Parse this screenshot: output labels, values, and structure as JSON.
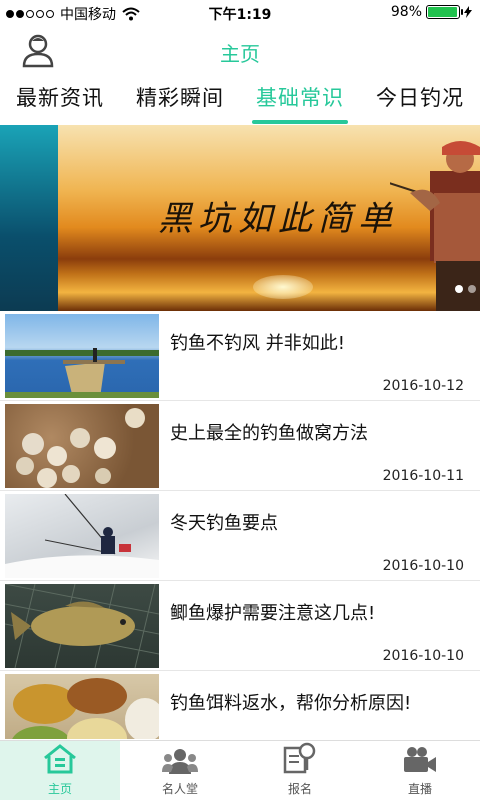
{
  "status_bar": {
    "carrier": "中国移动",
    "time": "下午1:19",
    "battery": "98%",
    "battery_level": 0.98
  },
  "header": {
    "title": "主页",
    "avatar_icon": "user-icon"
  },
  "tabs": [
    {
      "label": "最新资讯",
      "active": false
    },
    {
      "label": "精彩瞬间",
      "active": false
    },
    {
      "label": "基础常识",
      "active": true
    },
    {
      "label": "今日钓况",
      "active": false
    }
  ],
  "banner": {
    "caption": "黑坑如此简单",
    "page_count": 2,
    "active_page": 1
  },
  "news": [
    {
      "title": "钓鱼不钓风 并非如此!",
      "date": "2016-10-12"
    },
    {
      "title": "史上最全的钓鱼做窝方法",
      "date": "2016-10-11"
    },
    {
      "title": "冬天钓鱼要点",
      "date": "2016-10-10"
    },
    {
      "title": "鲫鱼爆护需要注意这几点!",
      "date": "2016-10-10"
    },
    {
      "title": "钓鱼饵料返水，帮你分析原因!",
      "date": ""
    }
  ],
  "tabbar": [
    {
      "label": "主页",
      "icon": "home-icon",
      "active": true
    },
    {
      "label": "名人堂",
      "icon": "people-icon",
      "active": false
    },
    {
      "label": "报名",
      "icon": "signup-icon",
      "active": false
    },
    {
      "label": "直播",
      "icon": "video-camera-icon",
      "active": false
    }
  ],
  "colors": {
    "accent": "#27c89a",
    "active_tab_bg": "#dff5ec"
  }
}
